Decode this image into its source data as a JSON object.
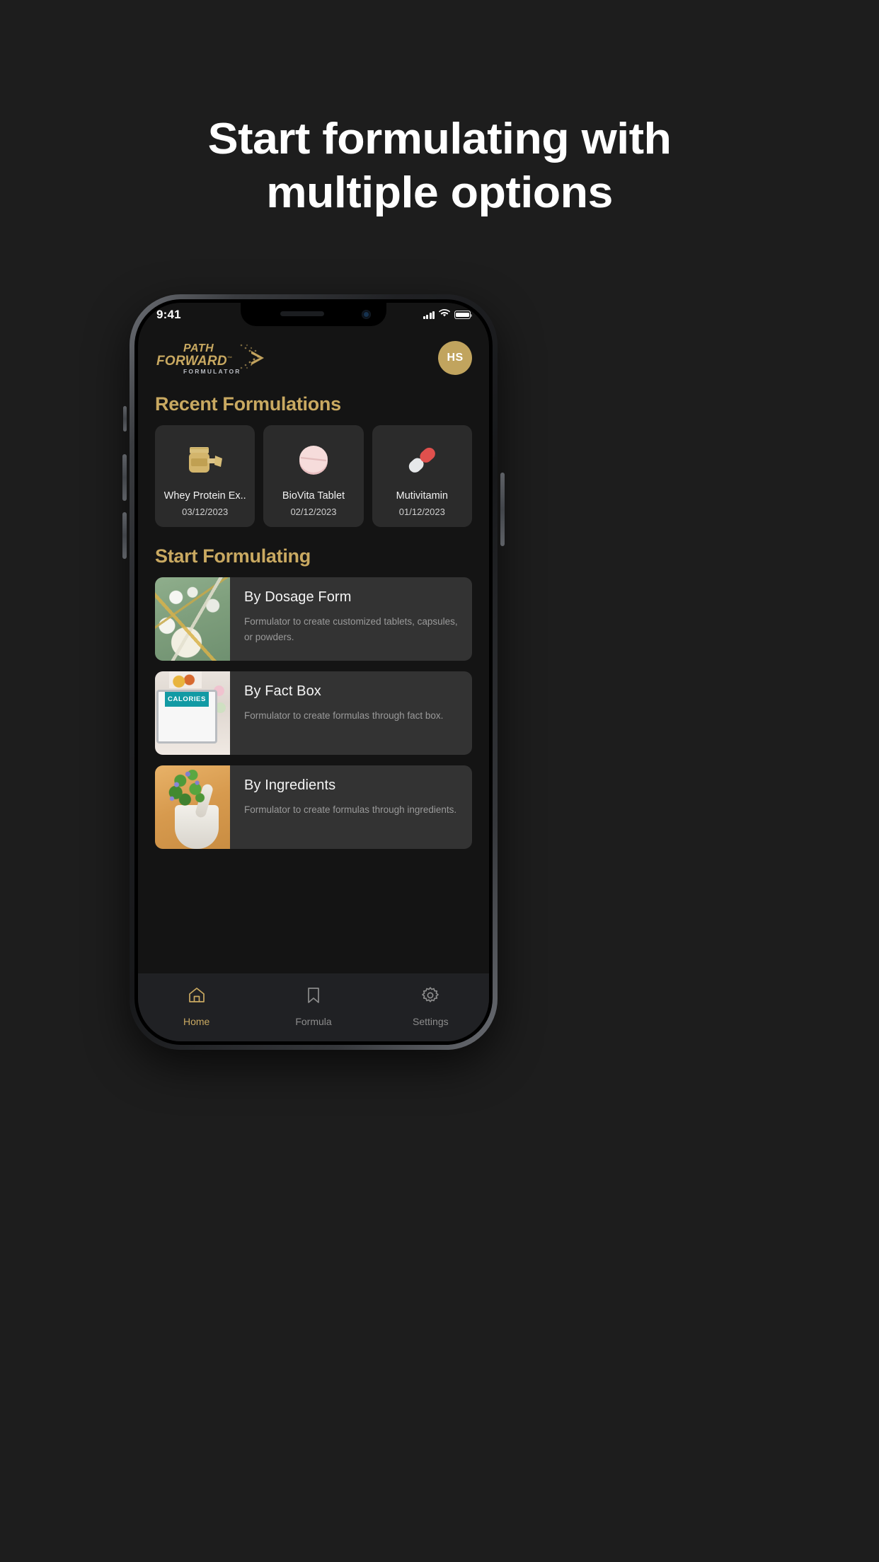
{
  "hero": {
    "line1": "Start formulating with",
    "line2": "multiple options"
  },
  "colors": {
    "page_bg": "#1d1d1d",
    "gold": "#c9a961",
    "card_bg": "#2b2b2b",
    "option_card_bg": "#333333",
    "tabbar_bg": "#202124",
    "avatar_bg": "#c1a45e"
  },
  "status_bar": {
    "time": "9:41",
    "signal_icon": "cellular-signal-icon",
    "wifi_icon": "wifi-icon",
    "battery_icon": "battery-icon"
  },
  "app_bar": {
    "logo": {
      "line1": "PATH",
      "line2": "FORWARD",
      "trademark": "™",
      "subtitle": "FORMULATOR",
      "chevron_icon": "dotted-chevron-icon"
    },
    "avatar": {
      "initials": "HS",
      "name": "user-avatar"
    }
  },
  "recent": {
    "title": "Recent Formulations",
    "cards": [
      {
        "icon": "protein-jar-icon",
        "name": "Whey Protein Ex..",
        "date": "03/12/2023"
      },
      {
        "icon": "round-tablet-icon",
        "name": "BioVita Tablet",
        "date": "02/12/2023"
      },
      {
        "icon": "capsule-icon",
        "name": "Mutivitamin",
        "date": "01/12/2023"
      }
    ]
  },
  "start_formulating": {
    "title": "Start Formulating",
    "options": [
      {
        "image": "pills-on-green-background-photo",
        "title": "By Dosage Form",
        "description": "Formulator to create customized tablets, capsules, or powders."
      },
      {
        "image": "calories-tablet-app-photo",
        "image_label": "CALORIES",
        "title": "By Fact Box",
        "description": "Formulator to create formulas through fact box."
      },
      {
        "image": "mortar-pestle-herbs-photo",
        "title": "By Ingredients",
        "description": "Formulator to create formulas through ingredients."
      }
    ]
  },
  "tabbar": {
    "items": [
      {
        "icon": "home-icon",
        "label": "Home",
        "active": true
      },
      {
        "icon": "bookmark-icon",
        "label": "Formula",
        "active": false
      },
      {
        "icon": "gear-icon",
        "label": "Settings",
        "active": false
      }
    ]
  }
}
